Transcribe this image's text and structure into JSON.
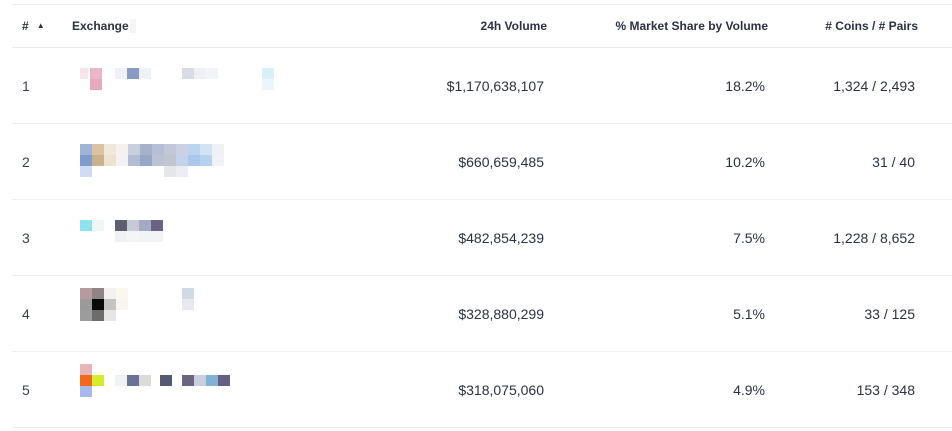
{
  "table": {
    "columns": {
      "rank": "#",
      "exchange": "Exchange",
      "volume": "24h Volume",
      "share": "% Market Share by Volume",
      "pairs": "# Coins / # Pairs"
    },
    "sort_icon": "sort-ascending-icon",
    "rows": [
      {
        "rank": "1",
        "volume": "$1,170,638,107",
        "share": "18.2%",
        "pairs": "1,324 / 2,493"
      },
      {
        "rank": "2",
        "volume": "$660,659,485",
        "share": "10.2%",
        "pairs": "31 / 40"
      },
      {
        "rank": "3",
        "volume": "$482,854,239",
        "share": "7.5%",
        "pairs": "1,228 / 8,652"
      },
      {
        "rank": "4",
        "volume": "$328,880,299",
        "share": "5.1%",
        "pairs": "33 / 125"
      },
      {
        "rank": "5",
        "volume": "$318,075,060",
        "share": "4.9%",
        "pairs": "153 / 348"
      }
    ]
  },
  "colors": {
    "text": "#2b3140",
    "border": "#eef0f3"
  }
}
